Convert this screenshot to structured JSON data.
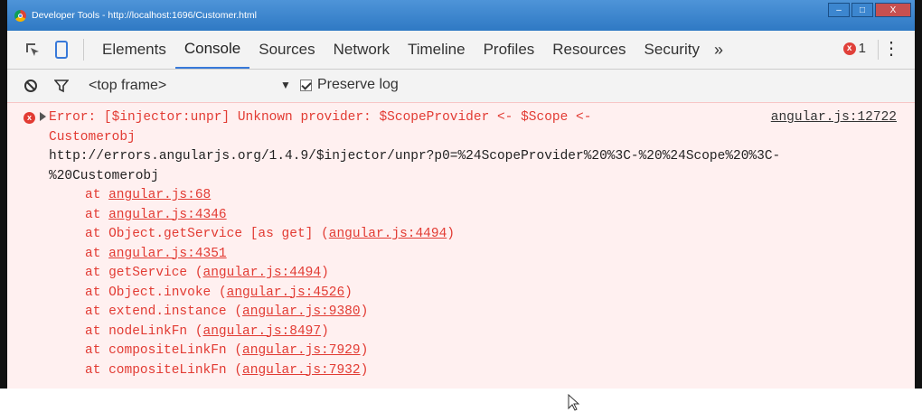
{
  "window": {
    "title": "Developer Tools - http://localhost:1696/Customer.html",
    "controls": {
      "minimize": "–",
      "maximize": "□",
      "close": "X"
    }
  },
  "toolbar": {
    "tabs": [
      "Elements",
      "Console",
      "Sources",
      "Network",
      "Timeline",
      "Profiles",
      "Resources",
      "Security"
    ],
    "active_tab": "Console",
    "overflow": "»",
    "error_count": "1",
    "error_glyph": "x",
    "menu": "⋮"
  },
  "filterbar": {
    "frame": "<top frame>",
    "frame_arrow": "▼",
    "preserve_log": "Preserve log",
    "preserve_checked": true
  },
  "console": {
    "error": {
      "icon": "x",
      "headline": "Error: [$injector:unpr] Unknown provider: $ScopeProvider <- $Scope <-",
      "headline_cont": "Customerobj",
      "source": "angular.js:12722",
      "url": "http://errors.angularjs.org/1.4.9/$injector/unpr?p0=%24ScopeProvider%20%3C-%20%24Scope%20%3C-",
      "url_cont": "%20Customerobj",
      "stack": [
        {
          "pre": "at ",
          "fn": "",
          "link": "angular.js:68"
        },
        {
          "pre": "at ",
          "fn": "",
          "link": "angular.js:4346"
        },
        {
          "pre": "at ",
          "fn": "Object.getService [as get] ",
          "link": "angular.js:4494"
        },
        {
          "pre": "at ",
          "fn": "",
          "link": "angular.js:4351"
        },
        {
          "pre": "at ",
          "fn": "getService ",
          "link": "angular.js:4494"
        },
        {
          "pre": "at ",
          "fn": "Object.invoke ",
          "link": "angular.js:4526"
        },
        {
          "pre": "at ",
          "fn": "extend.instance ",
          "link": "angular.js:9380"
        },
        {
          "pre": "at ",
          "fn": "nodeLinkFn ",
          "link": "angular.js:8497"
        },
        {
          "pre": "at ",
          "fn": "compositeLinkFn ",
          "link": "angular.js:7929"
        },
        {
          "pre": "at ",
          "fn": "compositeLinkFn ",
          "link": "angular.js:7932"
        }
      ]
    }
  },
  "colors": {
    "error": "#e23b33",
    "accent": "#3879d9",
    "titlebar": "#2f79c4"
  }
}
